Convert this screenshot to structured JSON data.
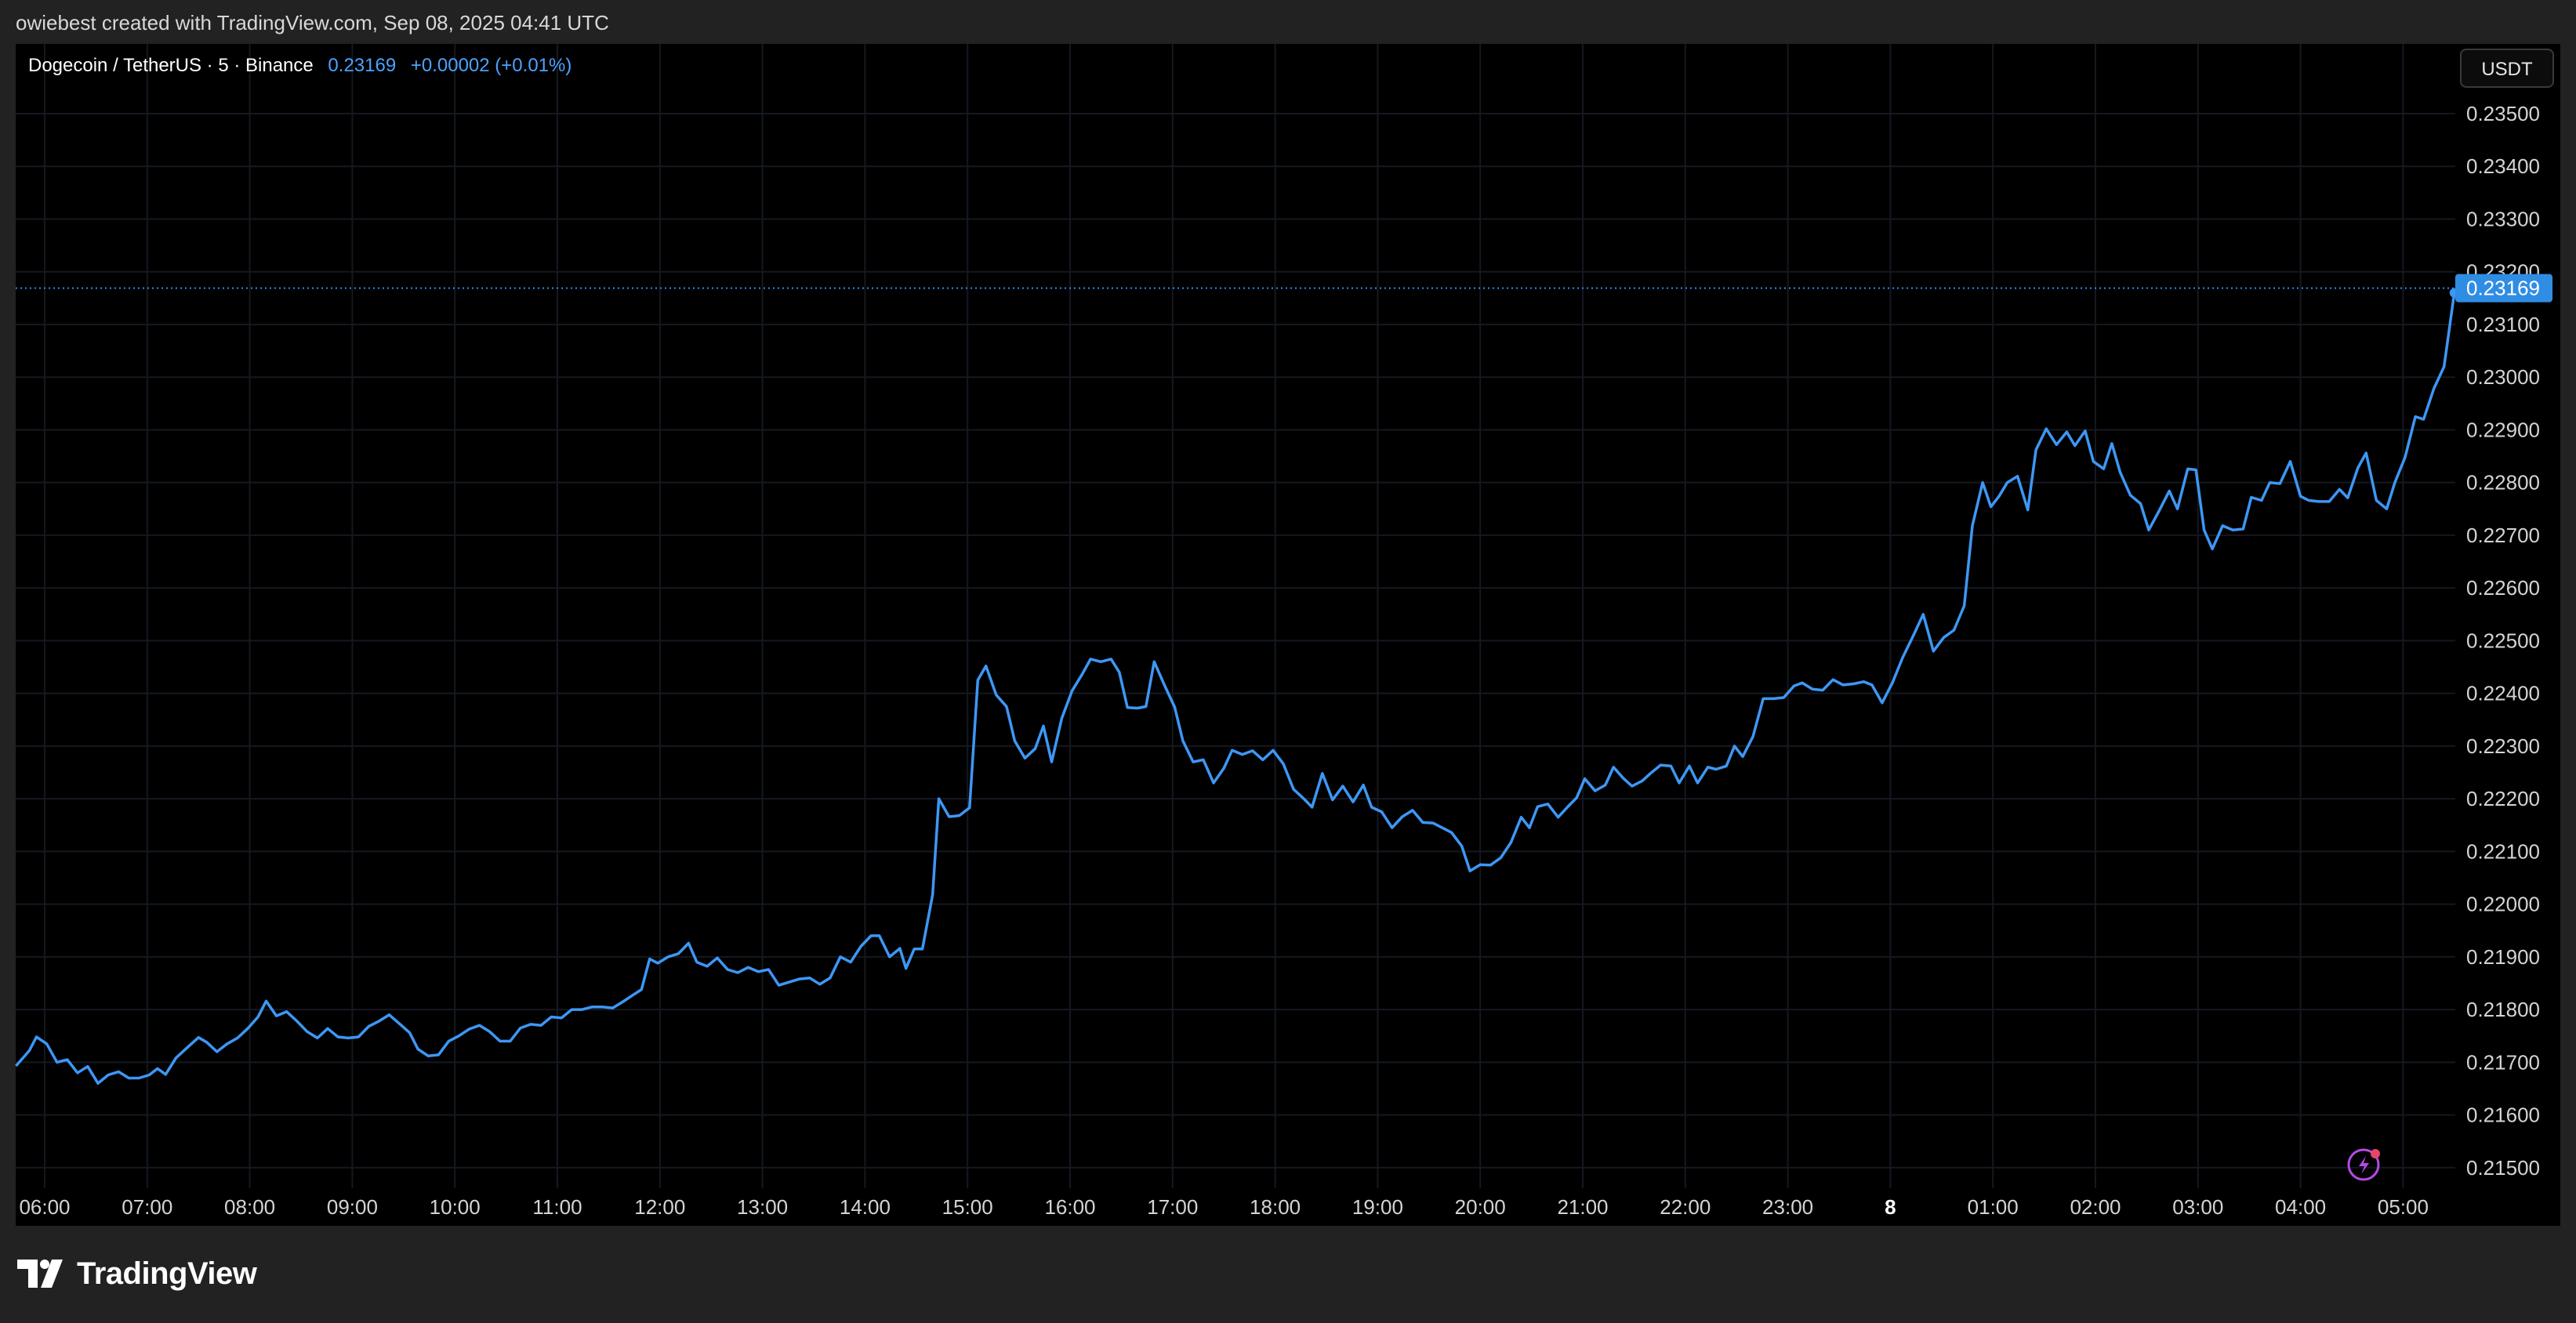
{
  "header": {
    "credit": "owiebest created with TradingView.com, Sep 08, 2025 04:41 UTC"
  },
  "legend": {
    "symbol": "Dogecoin / TetherUS · 5 · Binance",
    "price": "0.23169",
    "change": "+0.00002 (+0.01%)"
  },
  "currency_button": "USDT",
  "current_price_label": "0.23169",
  "footer": {
    "brand": "TradingView"
  },
  "colors": {
    "line": "#3d97f5",
    "price_tag": "#2f8de4",
    "background": "#000000",
    "frame": "#222222",
    "grid": "#141820"
  },
  "chart_data": {
    "type": "line",
    "title": "Dogecoin / TetherUS · 5 · Binance",
    "xlabel": "",
    "ylabel": "",
    "grid": true,
    "ylim": [
      0.215,
      0.2355
    ],
    "xlim": [
      5.75,
      29.5
    ],
    "x_ticks": [
      {
        "t": 6,
        "label": "06:00"
      },
      {
        "t": 7,
        "label": "07:00"
      },
      {
        "t": 8,
        "label": "08:00"
      },
      {
        "t": 9,
        "label": "09:00"
      },
      {
        "t": 10,
        "label": "10:00"
      },
      {
        "t": 11,
        "label": "11:00"
      },
      {
        "t": 12,
        "label": "12:00"
      },
      {
        "t": 13,
        "label": "13:00"
      },
      {
        "t": 14,
        "label": "14:00"
      },
      {
        "t": 15,
        "label": "15:00"
      },
      {
        "t": 16,
        "label": "16:00"
      },
      {
        "t": 17,
        "label": "17:00"
      },
      {
        "t": 18,
        "label": "18:00"
      },
      {
        "t": 19,
        "label": "19:00"
      },
      {
        "t": 20,
        "label": "20:00"
      },
      {
        "t": 21,
        "label": "21:00"
      },
      {
        "t": 22,
        "label": "22:00"
      },
      {
        "t": 23,
        "label": "23:00"
      },
      {
        "t": 24,
        "label": "8",
        "bold": true
      },
      {
        "t": 25,
        "label": "01:00"
      },
      {
        "t": 26,
        "label": "02:00"
      },
      {
        "t": 27,
        "label": "03:00"
      },
      {
        "t": 28,
        "label": "04:00"
      },
      {
        "t": 29,
        "label": "05:00"
      }
    ],
    "y_ticks": [
      {
        "v": 0.235,
        "label": "0.23500"
      },
      {
        "v": 0.234,
        "label": "0.23400"
      },
      {
        "v": 0.233,
        "label": "0.23300"
      },
      {
        "v": 0.232,
        "label": "0.23200"
      },
      {
        "v": 0.231,
        "label": "0.23100"
      },
      {
        "v": 0.23,
        "label": "0.23000"
      },
      {
        "v": 0.229,
        "label": "0.22900"
      },
      {
        "v": 0.228,
        "label": "0.22800"
      },
      {
        "v": 0.227,
        "label": "0.22700"
      },
      {
        "v": 0.226,
        "label": "0.22600"
      },
      {
        "v": 0.225,
        "label": "0.22500"
      },
      {
        "v": 0.224,
        "label": "0.22400"
      },
      {
        "v": 0.223,
        "label": "0.22300"
      },
      {
        "v": 0.222,
        "label": "0.22200"
      },
      {
        "v": 0.221,
        "label": "0.22100"
      },
      {
        "v": 0.22,
        "label": "0.22000"
      },
      {
        "v": 0.219,
        "label": "0.21900"
      },
      {
        "v": 0.218,
        "label": "0.21800"
      },
      {
        "v": 0.217,
        "label": "0.21700"
      },
      {
        "v": 0.216,
        "label": "0.21600"
      },
      {
        "v": 0.215,
        "label": "0.21500"
      }
    ],
    "current_price": 0.23169,
    "series": [
      {
        "points": [
          [
            5.72,
            0.21693
          ],
          [
            5.85,
            0.21722
          ],
          [
            5.92,
            0.21748
          ],
          [
            6.02,
            0.21735
          ],
          [
            6.12,
            0.217
          ],
          [
            6.22,
            0.21705
          ],
          [
            6.32,
            0.2168
          ],
          [
            6.42,
            0.21692
          ],
          [
            6.52,
            0.2166
          ],
          [
            6.62,
            0.21676
          ],
          [
            6.72,
            0.21682
          ],
          [
            6.82,
            0.2167
          ],
          [
            6.92,
            0.2167
          ],
          [
            7.02,
            0.21676
          ],
          [
            7.1,
            0.21688
          ],
          [
            7.18,
            0.21677
          ],
          [
            7.28,
            0.21708
          ],
          [
            7.38,
            0.21726
          ],
          [
            7.5,
            0.21747
          ],
          [
            7.58,
            0.21738
          ],
          [
            7.68,
            0.2172
          ],
          [
            7.78,
            0.21735
          ],
          [
            7.88,
            0.21746
          ],
          [
            7.98,
            0.21764
          ],
          [
            8.08,
            0.21786
          ],
          [
            8.16,
            0.21816
          ],
          [
            8.26,
            0.21788
          ],
          [
            8.36,
            0.21796
          ],
          [
            8.46,
            0.21778
          ],
          [
            8.56,
            0.21758
          ],
          [
            8.66,
            0.21746
          ],
          [
            8.76,
            0.21764
          ],
          [
            8.86,
            0.21748
          ],
          [
            8.96,
            0.21746
          ],
          [
            9.06,
            0.21748
          ],
          [
            9.16,
            0.21768
          ],
          [
            9.26,
            0.21778
          ],
          [
            9.36,
            0.2179
          ],
          [
            9.46,
            0.21773
          ],
          [
            9.56,
            0.21756
          ],
          [
            9.64,
            0.21725
          ],
          [
            9.74,
            0.21712
          ],
          [
            9.84,
            0.21714
          ],
          [
            9.94,
            0.2174
          ],
          [
            10.04,
            0.2175
          ],
          [
            10.14,
            0.21763
          ],
          [
            10.24,
            0.2177
          ],
          [
            10.34,
            0.21758
          ],
          [
            10.44,
            0.2174
          ],
          [
            10.54,
            0.2174
          ],
          [
            10.64,
            0.21765
          ],
          [
            10.74,
            0.21772
          ],
          [
            10.84,
            0.2177
          ],
          [
            10.94,
            0.21786
          ],
          [
            11.04,
            0.21784
          ],
          [
            11.14,
            0.218
          ],
          [
            11.24,
            0.218
          ],
          [
            11.34,
            0.21805
          ],
          [
            11.44,
            0.21805
          ],
          [
            11.54,
            0.21803
          ],
          [
            11.64,
            0.21815
          ],
          [
            11.74,
            0.21828
          ],
          [
            11.82,
            0.21838
          ],
          [
            11.9,
            0.21896
          ],
          [
            11.98,
            0.21888
          ],
          [
            12.08,
            0.219
          ],
          [
            12.18,
            0.21906
          ],
          [
            12.28,
            0.21926
          ],
          [
            12.36,
            0.2189
          ],
          [
            12.46,
            0.21882
          ],
          [
            12.56,
            0.21898
          ],
          [
            12.66,
            0.21876
          ],
          [
            12.76,
            0.2187
          ],
          [
            12.86,
            0.2188
          ],
          [
            12.96,
            0.21872
          ],
          [
            13.06,
            0.21876
          ],
          [
            13.16,
            0.21846
          ],
          [
            13.26,
            0.21852
          ],
          [
            13.36,
            0.21858
          ],
          [
            13.46,
            0.2186
          ],
          [
            13.56,
            0.21848
          ],
          [
            13.66,
            0.2186
          ],
          [
            13.76,
            0.219
          ],
          [
            13.86,
            0.2189
          ],
          [
            13.96,
            0.2192
          ],
          [
            14.06,
            0.2194
          ],
          [
            14.14,
            0.2194
          ],
          [
            14.24,
            0.219
          ],
          [
            14.34,
            0.21916
          ],
          [
            14.4,
            0.21878
          ],
          [
            14.48,
            0.21915
          ],
          [
            14.56,
            0.21915
          ],
          [
            14.66,
            0.22018
          ],
          [
            14.72,
            0.222
          ],
          [
            14.82,
            0.22166
          ],
          [
            14.92,
            0.22168
          ],
          [
            15.02,
            0.22183
          ],
          [
            15.1,
            0.22425
          ],
          [
            15.18,
            0.22452
          ],
          [
            15.28,
            0.22397
          ],
          [
            15.38,
            0.22375
          ],
          [
            15.46,
            0.2231
          ],
          [
            15.56,
            0.22277
          ],
          [
            15.66,
            0.22295
          ],
          [
            15.74,
            0.22338
          ],
          [
            15.82,
            0.2227
          ],
          [
            15.92,
            0.22353
          ],
          [
            16.02,
            0.22405
          ],
          [
            16.12,
            0.22437
          ],
          [
            16.2,
            0.22465
          ],
          [
            16.3,
            0.2246
          ],
          [
            16.4,
            0.22465
          ],
          [
            16.48,
            0.2244
          ],
          [
            16.56,
            0.22373
          ],
          [
            16.66,
            0.22372
          ],
          [
            16.74,
            0.22375
          ],
          [
            16.82,
            0.2246
          ],
          [
            16.92,
            0.22416
          ],
          [
            17.02,
            0.22374
          ],
          [
            17.1,
            0.2231
          ],
          [
            17.2,
            0.2227
          ],
          [
            17.3,
            0.22274
          ],
          [
            17.4,
            0.2223
          ],
          [
            17.5,
            0.22258
          ],
          [
            17.58,
            0.22292
          ],
          [
            17.68,
            0.22284
          ],
          [
            17.78,
            0.22291
          ],
          [
            17.88,
            0.22274
          ],
          [
            17.98,
            0.22292
          ],
          [
            18.08,
            0.22266
          ],
          [
            18.18,
            0.22218
          ],
          [
            18.28,
            0.222
          ],
          [
            18.36,
            0.22184
          ],
          [
            18.46,
            0.22248
          ],
          [
            18.56,
            0.22198
          ],
          [
            18.66,
            0.22224
          ],
          [
            18.76,
            0.22194
          ],
          [
            18.86,
            0.22226
          ],
          [
            18.94,
            0.22184
          ],
          [
            19.04,
            0.22175
          ],
          [
            19.14,
            0.22145
          ],
          [
            19.24,
            0.22166
          ],
          [
            19.34,
            0.22178
          ],
          [
            19.44,
            0.22155
          ],
          [
            19.54,
            0.22154
          ],
          [
            19.64,
            0.22144
          ],
          [
            19.72,
            0.22136
          ],
          [
            19.82,
            0.2211
          ],
          [
            19.9,
            0.22063
          ],
          [
            20.0,
            0.22075
          ],
          [
            20.1,
            0.22074
          ],
          [
            20.2,
            0.22088
          ],
          [
            20.3,
            0.22117
          ],
          [
            20.4,
            0.22165
          ],
          [
            20.48,
            0.22145
          ],
          [
            20.56,
            0.22185
          ],
          [
            20.66,
            0.2219
          ],
          [
            20.76,
            0.22165
          ],
          [
            20.86,
            0.22186
          ],
          [
            20.94,
            0.22202
          ],
          [
            21.02,
            0.22238
          ],
          [
            21.12,
            0.22215
          ],
          [
            21.22,
            0.22226
          ],
          [
            21.3,
            0.2226
          ],
          [
            21.4,
            0.22238
          ],
          [
            21.48,
            0.22224
          ],
          [
            21.58,
            0.22234
          ],
          [
            21.66,
            0.22248
          ],
          [
            21.76,
            0.22264
          ],
          [
            21.86,
            0.22262
          ],
          [
            21.94,
            0.2223
          ],
          [
            22.04,
            0.22262
          ],
          [
            22.12,
            0.2223
          ],
          [
            22.22,
            0.2226
          ],
          [
            22.3,
            0.22256
          ],
          [
            22.4,
            0.22262
          ],
          [
            22.48,
            0.223
          ],
          [
            22.56,
            0.2228
          ],
          [
            22.66,
            0.22318
          ],
          [
            22.76,
            0.2239
          ],
          [
            22.86,
            0.2239
          ],
          [
            22.96,
            0.22392
          ],
          [
            23.06,
            0.22414
          ],
          [
            23.14,
            0.2242
          ],
          [
            23.24,
            0.22408
          ],
          [
            23.34,
            0.22406
          ],
          [
            23.44,
            0.22426
          ],
          [
            23.54,
            0.22416
          ],
          [
            23.64,
            0.22418
          ],
          [
            23.74,
            0.22422
          ],
          [
            23.82,
            0.22416
          ],
          [
            23.92,
            0.22382
          ],
          [
            24.02,
            0.2242
          ],
          [
            24.12,
            0.22468
          ],
          [
            24.22,
            0.22508
          ],
          [
            24.32,
            0.2255
          ],
          [
            24.42,
            0.2248
          ],
          [
            24.52,
            0.22506
          ],
          [
            24.62,
            0.2252
          ],
          [
            24.72,
            0.22566
          ],
          [
            24.8,
            0.22718
          ],
          [
            24.9,
            0.228
          ],
          [
            24.98,
            0.22754
          ],
          [
            25.06,
            0.22774
          ],
          [
            25.14,
            0.228
          ],
          [
            25.24,
            0.22812
          ],
          [
            25.34,
            0.22748
          ],
          [
            25.42,
            0.22862
          ],
          [
            25.52,
            0.22902
          ],
          [
            25.62,
            0.22872
          ],
          [
            25.72,
            0.22896
          ],
          [
            25.8,
            0.2287
          ],
          [
            25.9,
            0.22898
          ],
          [
            25.98,
            0.2284
          ],
          [
            26.08,
            0.22826
          ],
          [
            26.16,
            0.22874
          ],
          [
            26.24,
            0.2282
          ],
          [
            26.34,
            0.22776
          ],
          [
            26.44,
            0.2276
          ],
          [
            26.52,
            0.2271
          ],
          [
            26.62,
            0.22746
          ],
          [
            26.72,
            0.22784
          ],
          [
            26.8,
            0.2275
          ],
          [
            26.9,
            0.22826
          ],
          [
            26.98,
            0.22824
          ],
          [
            27.06,
            0.2271
          ],
          [
            27.14,
            0.22674
          ],
          [
            27.24,
            0.22718
          ],
          [
            27.34,
            0.2271
          ],
          [
            27.44,
            0.22712
          ],
          [
            27.52,
            0.22772
          ],
          [
            27.62,
            0.22766
          ],
          [
            27.7,
            0.228
          ],
          [
            27.8,
            0.22798
          ],
          [
            27.9,
            0.2284
          ],
          [
            28.0,
            0.22774
          ],
          [
            28.08,
            0.22766
          ],
          [
            28.18,
            0.22764
          ],
          [
            28.28,
            0.22764
          ],
          [
            28.38,
            0.22787
          ],
          [
            28.46,
            0.22771
          ],
          [
            28.56,
            0.22828
          ],
          [
            28.64,
            0.22856
          ],
          [
            28.74,
            0.22766
          ],
          [
            28.84,
            0.2275
          ],
          [
            28.92,
            0.228
          ],
          [
            29.02,
            0.22848
          ],
          [
            29.12,
            0.22925
          ],
          [
            29.2,
            0.2292
          ],
          [
            29.3,
            0.22978
          ],
          [
            29.4,
            0.2302
          ],
          [
            29.5,
            0.2316
          ]
        ]
      }
    ]
  }
}
